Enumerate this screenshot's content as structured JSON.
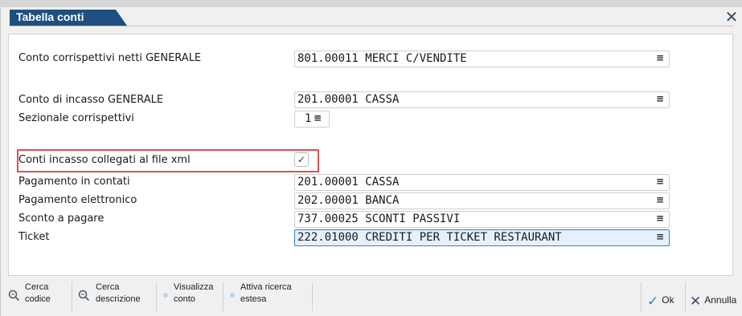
{
  "window": {
    "title": "Tabella conti",
    "close_glyph": "✕"
  },
  "fields": {
    "corrispettivi_netti": {
      "label": "Conto corrispettivi netti GENERALE",
      "value": "801.00011 MERCI C/VENDITE"
    },
    "incasso_generale": {
      "label": "Conto di incasso GENERALE",
      "value": "201.00001 CASSA"
    },
    "sezionale": {
      "label": "Sezionale corrispettivi",
      "value": "1"
    },
    "conti_collegati": {
      "label": "Conti incasso collegati al file xml",
      "checked": true,
      "check_glyph": "✓"
    },
    "pagamento_contanti": {
      "label": "Pagamento in contati",
      "value": "201.00001 CASSA"
    },
    "pagamento_elettronico": {
      "label": "Pagamento elettronico",
      "value": "202.00001 BANCA"
    },
    "sconto_pagare": {
      "label": "Sconto a pagare",
      "value": "737.00025 SCONTI PASSIVI"
    },
    "ticket": {
      "label": "Ticket",
      "value": "222.01000 CREDITI PER TICKET RESTAURANT"
    }
  },
  "lookup_glyph": "≡",
  "toolbar": {
    "cerca_codice": {
      "line1": "Cerca",
      "line2": "codice",
      "icon": "search-icon"
    },
    "cerca_descrizione": {
      "line1": "Cerca",
      "line2": "descrizione",
      "icon": "search-icon"
    },
    "visualizza_conto": {
      "line1": "Visualizza",
      "line2": "conto"
    },
    "attiva_ricerca": {
      "line1": "Attiva ricerca",
      "line2": "estesa"
    },
    "ok_label": "Ok",
    "annulla_label": "Annulla"
  },
  "colors": {
    "title_tab": "#1f4f80",
    "highlight_border": "#d9534f",
    "active_field_border": "#2f83d2"
  }
}
